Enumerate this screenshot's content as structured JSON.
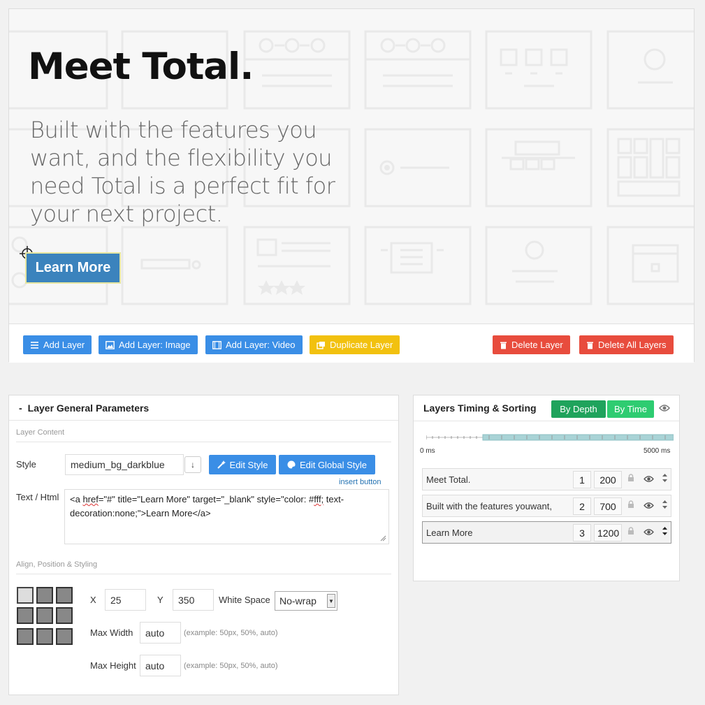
{
  "slide": {
    "title": "Meet Total.",
    "body": "Built with the features you want, and the flexibility you need Total is a perfect fit for your next project.",
    "button_label": "Learn More"
  },
  "toolbar": {
    "add_layer": "Add Layer",
    "add_layer_image": "Add Layer: Image",
    "add_layer_video": "Add Layer: Video",
    "duplicate_layer": "Duplicate Layer",
    "delete_layer": "Delete Layer",
    "delete_all_layers": "Delete All Layers"
  },
  "params": {
    "toggle": "-",
    "title": "Layer General Parameters",
    "content_section": "Layer Content",
    "style_label": "Style",
    "style_value": "medium_bg_darkblue",
    "style_dropdown": "↓",
    "edit_style": "Edit Style",
    "edit_global_style": "Edit Global Style",
    "insert_button": "insert button",
    "text_label": "Text / Html",
    "html_parts": [
      "<a ",
      "href",
      "=\"#\" title=\"Learn More\" target=\"_blank\" style=\"color: #",
      "fff;",
      " text-decoration:none;\">Learn More</a>"
    ],
    "position_section": "Align, Position & Styling",
    "x_label": "X",
    "x_value": "25",
    "y_label": "Y",
    "y_value": "350",
    "whitespace_label": "White Space",
    "whitespace_value": "No-wrap",
    "maxwidth_label": "Max Width",
    "maxwidth_value": "auto",
    "maxwidth_hint": "(example: 50px, 50%, auto)",
    "maxheight_label": "Max Height",
    "maxheight_value": "auto",
    "maxheight_hint": "(example: 50px, 50%, auto)"
  },
  "timing": {
    "title": "Layers Timing & Sorting",
    "by_depth": "By Depth",
    "by_time": "By Time",
    "start_label": "0 ms",
    "end_label": "5000 ms",
    "layers": [
      {
        "name": "Meet Total.",
        "order": "1",
        "time": "200"
      },
      {
        "name": "Built with the features youwant,",
        "order": "2",
        "time": "700"
      },
      {
        "name": "Learn More",
        "order": "3",
        "time": "1200"
      }
    ]
  }
}
